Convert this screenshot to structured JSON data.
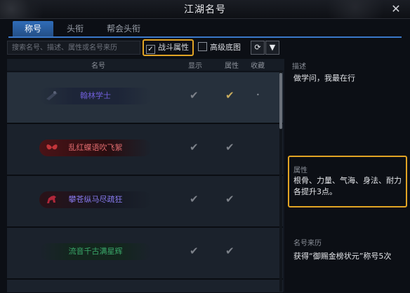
{
  "window": {
    "title": "江湖名号"
  },
  "tabs": [
    {
      "label": "称号",
      "active": true
    },
    {
      "label": "头衔",
      "active": false
    },
    {
      "label": "帮会头衔",
      "active": false
    }
  ],
  "search": {
    "placeholder": "搜索名号、描述、属性或名号来历"
  },
  "filters": {
    "combat_attr": {
      "label": "战斗属性",
      "checked": true
    },
    "advanced_bg": {
      "label": "高级底图",
      "checked": false
    }
  },
  "list": {
    "headers": {
      "name": "名号",
      "display": "显示",
      "attr": "属性",
      "fav": "收藏"
    },
    "rows": [
      {
        "name": "翰林学士",
        "display": true,
        "attr": true,
        "attr_active": true,
        "fav": "•",
        "color": "#6f5ed8"
      },
      {
        "name": "乱红蝶语吹飞絮",
        "display": true,
        "attr": true,
        "attr_active": false,
        "fav": "",
        "color": "#c2353a"
      },
      {
        "name": "攀苍纵马尽疏狂",
        "display": true,
        "attr": true,
        "attr_active": false,
        "fav": "",
        "color": "#7d6ef0"
      },
      {
        "name": "流音千古满星辉",
        "display": true,
        "attr": true,
        "attr_active": false,
        "fav": "",
        "color": "#3aa86a"
      }
    ]
  },
  "detail": {
    "desc_label": "描述",
    "desc": "做学问，我最在行",
    "attr_label": "属性",
    "attr": "根骨、力量、气海、身法、耐力各提升3点。",
    "origin_label": "名号来历",
    "origin": "获得“御赐金榜状元”称号5次"
  },
  "icons": {
    "close": "close-icon",
    "refresh": "refresh-icon",
    "filter": "filter-icon"
  },
  "colors": {
    "accent": "#3a78c9",
    "highlight": "#e2a424",
    "gold_check": "#c9ad5e"
  }
}
